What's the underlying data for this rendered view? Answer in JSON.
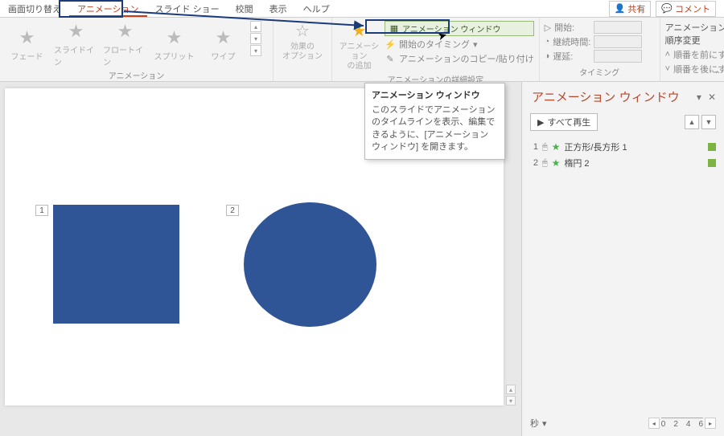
{
  "tabs": {
    "items": [
      "画面切り替え",
      "アニメーション",
      "スライド ショー",
      "校閲",
      "表示",
      "ヘルプ"
    ],
    "share": "共有",
    "comment": "コメント"
  },
  "ribbon": {
    "gallery_items": [
      "フェード",
      "スライドイン",
      "フロートイン",
      "スプリット",
      "ワイプ"
    ],
    "effect_options": "効果の\nオプション",
    "add_animation": "アニメーション\nの追加",
    "anim_pane_btn": "アニメーション ウィンドウ",
    "trigger": "開始のタイミング",
    "painter": "アニメーションのコピー/貼り付け",
    "start_label": "開始:",
    "duration_label": "継続時間:",
    "delay_label": "遅延:",
    "order_title": "アニメーションの順序変更",
    "order_earlier": "順番を前にする",
    "order_later": "順番を後にする",
    "group_anim": "アニメーション",
    "group_adv": "アニメーションの詳細設定",
    "group_timing": "タイミング"
  },
  "tooltip": {
    "title": "アニメーション ウィンドウ",
    "body": "このスライドでアニメーションのタイムラインを表示、編集できるように、[アニメーション ウィンドウ] を開きます。"
  },
  "slide": {
    "tag1": "1",
    "tag2": "2"
  },
  "pane": {
    "title": "アニメーション ウィンドウ",
    "play_all": "すべて再生",
    "items": [
      {
        "n": "1",
        "name": "正方形/長方形 1"
      },
      {
        "n": "2",
        "name": "楕円 2"
      }
    ],
    "seconds": "秒",
    "ticks": [
      "0",
      "2",
      "4",
      "6"
    ]
  }
}
